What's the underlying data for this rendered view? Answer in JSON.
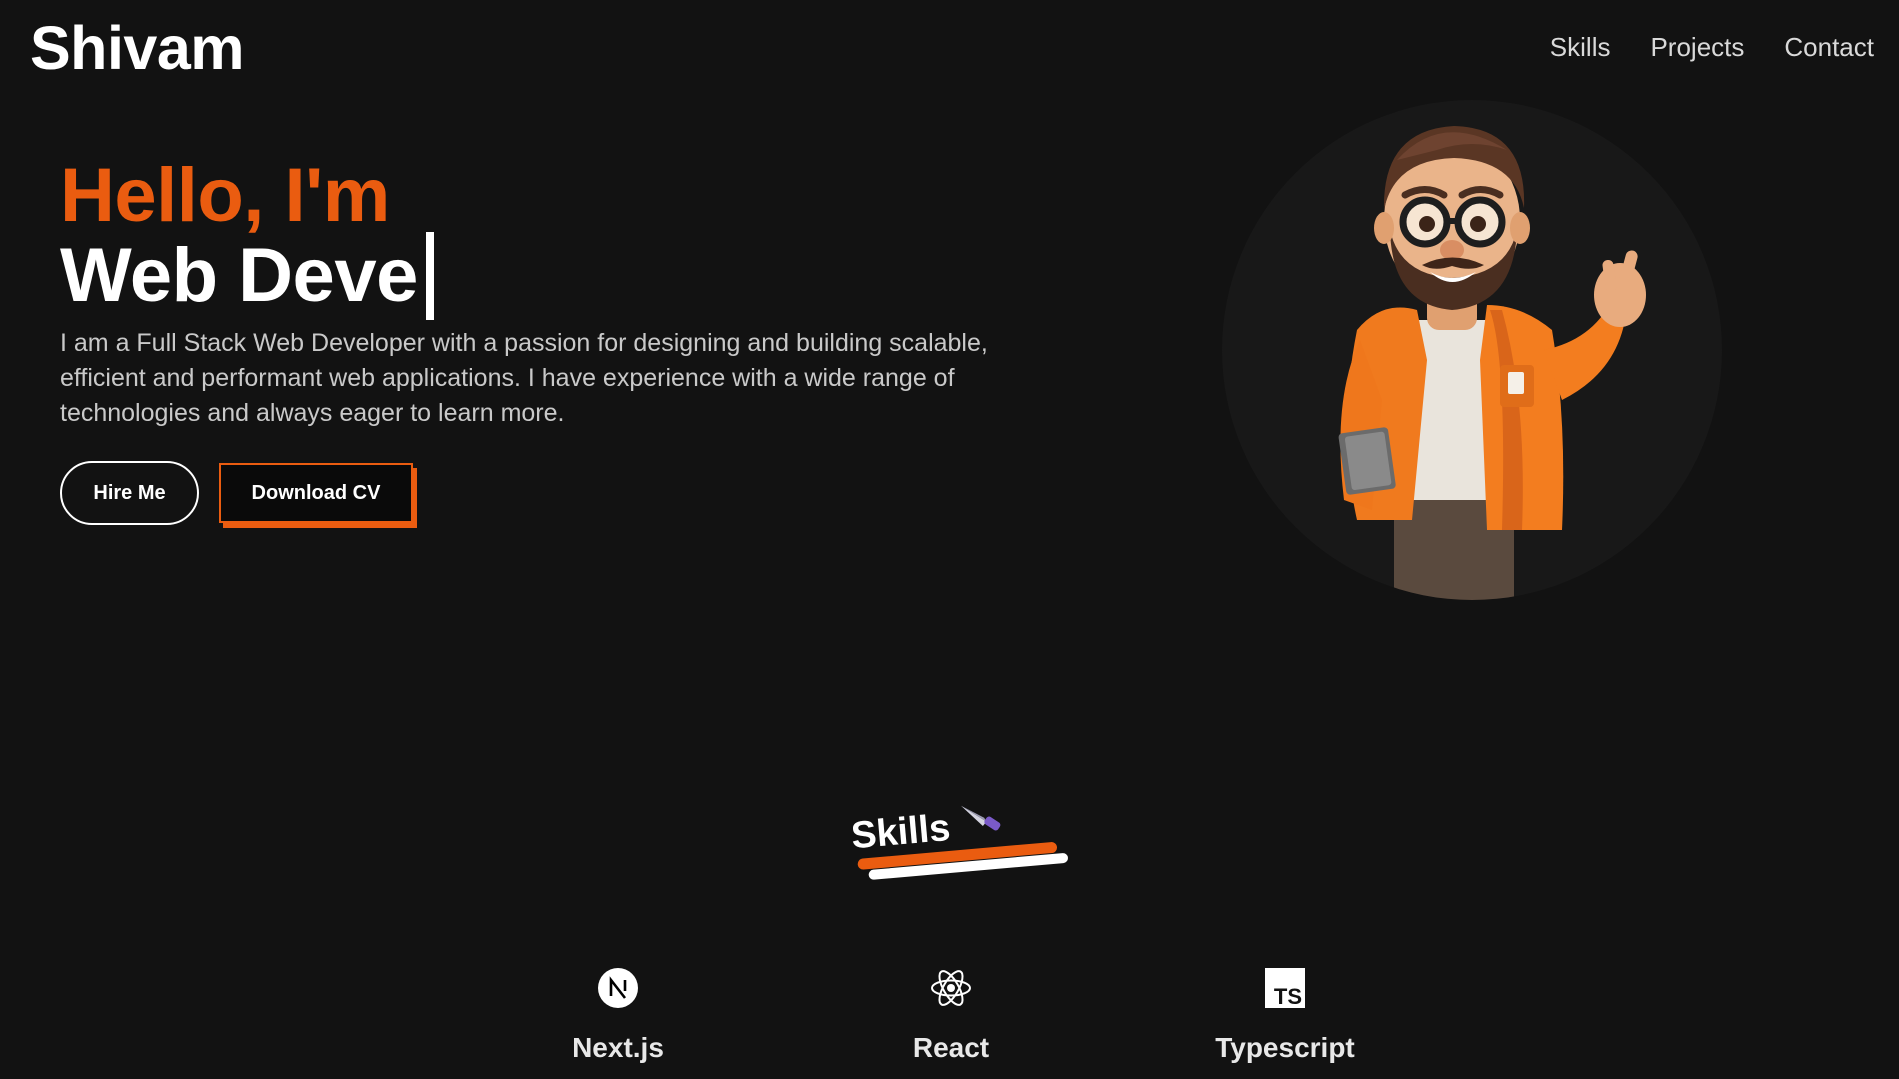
{
  "header": {
    "logo": "Shivam",
    "nav": [
      "Skills",
      "Projects",
      "Contact"
    ]
  },
  "hero": {
    "greeting": "Hello, I'm",
    "role_typed": "Web Deve",
    "description": "I am a Full Stack Web Developer with a passion for designing and building scalable, efficient and performant web applications. I have experience with a wide range of technologies and always eager to learn more.",
    "hire_button": "Hire Me",
    "cv_button": "Download CV"
  },
  "skills": {
    "heading": "Skills",
    "heading_icon": "knife-icon",
    "items": [
      {
        "name": "Next.js",
        "icon": "nextjs-icon"
      },
      {
        "name": "React",
        "icon": "react-icon"
      },
      {
        "name": "Typescript",
        "icon": "typescript-icon"
      }
    ]
  },
  "colors": {
    "background": "#121212",
    "accent": "#ea5c10",
    "text": "#ffffff",
    "muted_text": "#c9c9c9"
  }
}
